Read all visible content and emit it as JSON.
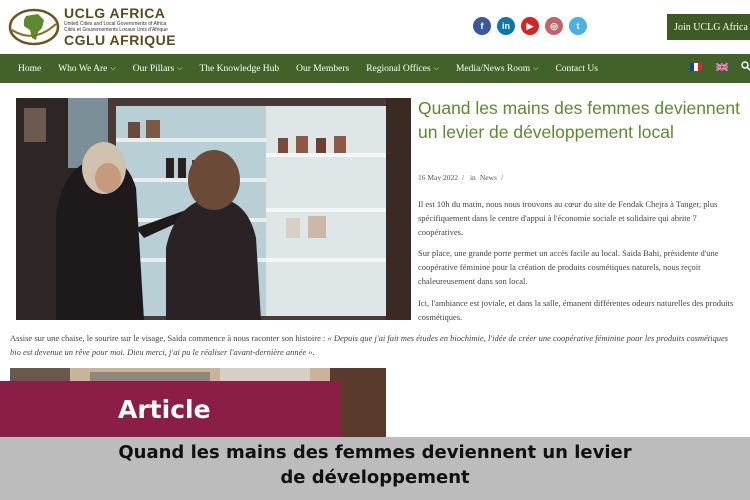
{
  "header": {
    "logo": {
      "title_en": "UCLG AFRICA",
      "subtitle_1": "United Cities and Local Governments of Africa",
      "subtitle_2": "Cités et Gouvernements Locaux Unis d'Afrique",
      "title_fr": "CGLU AFRIQUE"
    },
    "socials": [
      {
        "icon": "facebook-icon",
        "glyph": "f",
        "color": "#3b5998"
      },
      {
        "icon": "linkedin-icon",
        "glyph": "in",
        "color": "#0e76a8"
      },
      {
        "icon": "youtube-icon",
        "glyph": "▶",
        "color": "#d62323"
      },
      {
        "icon": "instagram-icon",
        "glyph": "◎",
        "color": "#c0646a"
      },
      {
        "icon": "twitter-icon",
        "glyph": "t",
        "color": "#4cb0e8"
      }
    ],
    "join_label": "Join UCLG Africa"
  },
  "nav": {
    "items": [
      {
        "label": "Home",
        "dropdown": false
      },
      {
        "label": "Who We Are",
        "dropdown": true
      },
      {
        "label": "Our Pillars",
        "dropdown": true
      },
      {
        "label": "The Knowledge Hub",
        "dropdown": false
      },
      {
        "label": "Our Members",
        "dropdown": false
      },
      {
        "label": "Regional Offices",
        "dropdown": true
      },
      {
        "label": "Media/News Room",
        "dropdown": true
      },
      {
        "label": "Contact Us",
        "dropdown": false
      }
    ],
    "languages": [
      "fr-flag-icon",
      "en-flag-icon"
    ],
    "search_icon": "search-icon"
  },
  "article": {
    "title": "Quand les mains des femmes deviennent un levier de développement local",
    "date": "16 May 2022",
    "category_prefix": "in",
    "category": "News",
    "paragraphs": [
      "Il est 10h du matin, nous nous trouvons au cœur du site de Fendak Chejra à Tanger, plus spécifiquement dans le centre d'appui à l'économie sociale et solidaire qui abrite 7 coopératives.",
      "Sur place, une grande porte permet un accès facile au local.  Saida Bahi, présidente d'une coopérative féminine pour la création de produits cosmétiques naturels, nous reçoit chaleureusement dans son local.",
      "Ici, l'ambiance est joviale, et dans  la salle, émanent différentes odeurs naturelles des produits cosmétiques."
    ],
    "quote_intro": "Assise sur une chaise, le sourire sur le visage, Saïda commence à nous raconter son histoire : ",
    "quote_text": "« Depuis que j'ai fait mes études en biochimie, l'idée de créer une coopérative féminine pour les produits cosmétiques bio est devenue un rêve pour moi. Dieu merci, j'ai pu le réaliser l'avant-dernière année »",
    "quote_end": "."
  },
  "overlay": {
    "label": "Article",
    "title_line1": "Quand les mains des femmes deviennent un levier",
    "title_line2": "de développement"
  }
}
